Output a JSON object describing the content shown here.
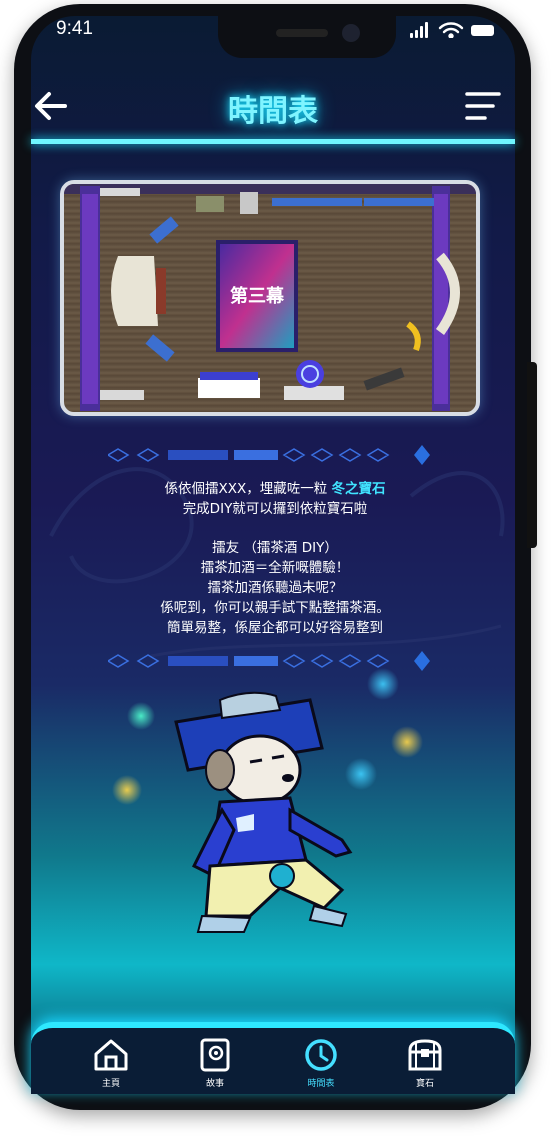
{
  "status_bar": {
    "time": "9:41"
  },
  "header": {
    "title": "時間表"
  },
  "floor_plan": {
    "poster_text": "第三幕"
  },
  "intro": {
    "line1_prefix": "係依個擂XXX，埋藏咗一粒",
    "line1_highlight": "冬之寶石",
    "line2": "完成DIY就可以攞到依粒寶石啦"
  },
  "activity": {
    "line1": "擂友 （擂茶酒 DIY）",
    "line2": "擂茶加酒＝全新嘅體驗！",
    "line3": "擂茶加酒係聽過未呢？",
    "line4": "係呢到，你可以親手試下點整擂茶酒。",
    "line5": "簡單易整，係屋企都可以好容易整到"
  },
  "tabbar": {
    "items": [
      {
        "label": "主頁",
        "icon": "home-icon"
      },
      {
        "label": "故事",
        "icon": "book-icon"
      },
      {
        "label": "時間表",
        "icon": "clock-icon"
      },
      {
        "label": "寶石",
        "icon": "treasure-chest-icon"
      }
    ],
    "active_index": 2
  },
  "colors": {
    "accent": "#40e4ff",
    "title_glow": "#7ff4ff",
    "tabbar_bg": "#0a1d36"
  }
}
